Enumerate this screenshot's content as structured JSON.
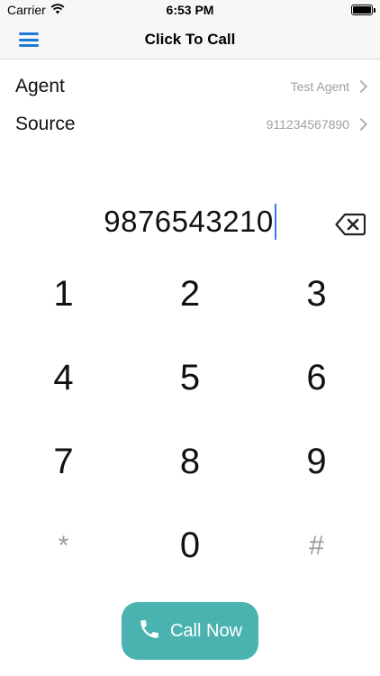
{
  "status_bar": {
    "carrier": "Carrier",
    "time": "6:53 PM"
  },
  "nav": {
    "title": "Click To Call"
  },
  "agent": {
    "label": "Agent",
    "value": "Test Agent"
  },
  "source": {
    "label": "Source",
    "value": "911234567890"
  },
  "dialer": {
    "number": "9876543210"
  },
  "keypad": {
    "keys": [
      "1",
      "2",
      "3",
      "4",
      "5",
      "6",
      "7",
      "8",
      "9",
      "*",
      "0",
      "#"
    ]
  },
  "call_button": {
    "label": "Call Now"
  },
  "colors": {
    "accent_blue": "#1e7ad6",
    "call_teal": "#4ab3b0",
    "muted": "#a0a0a0"
  },
  "icons": [
    "wifi-icon",
    "battery-icon",
    "menu-icon",
    "chevron-right-icon",
    "backspace-icon",
    "phone-icon"
  ]
}
